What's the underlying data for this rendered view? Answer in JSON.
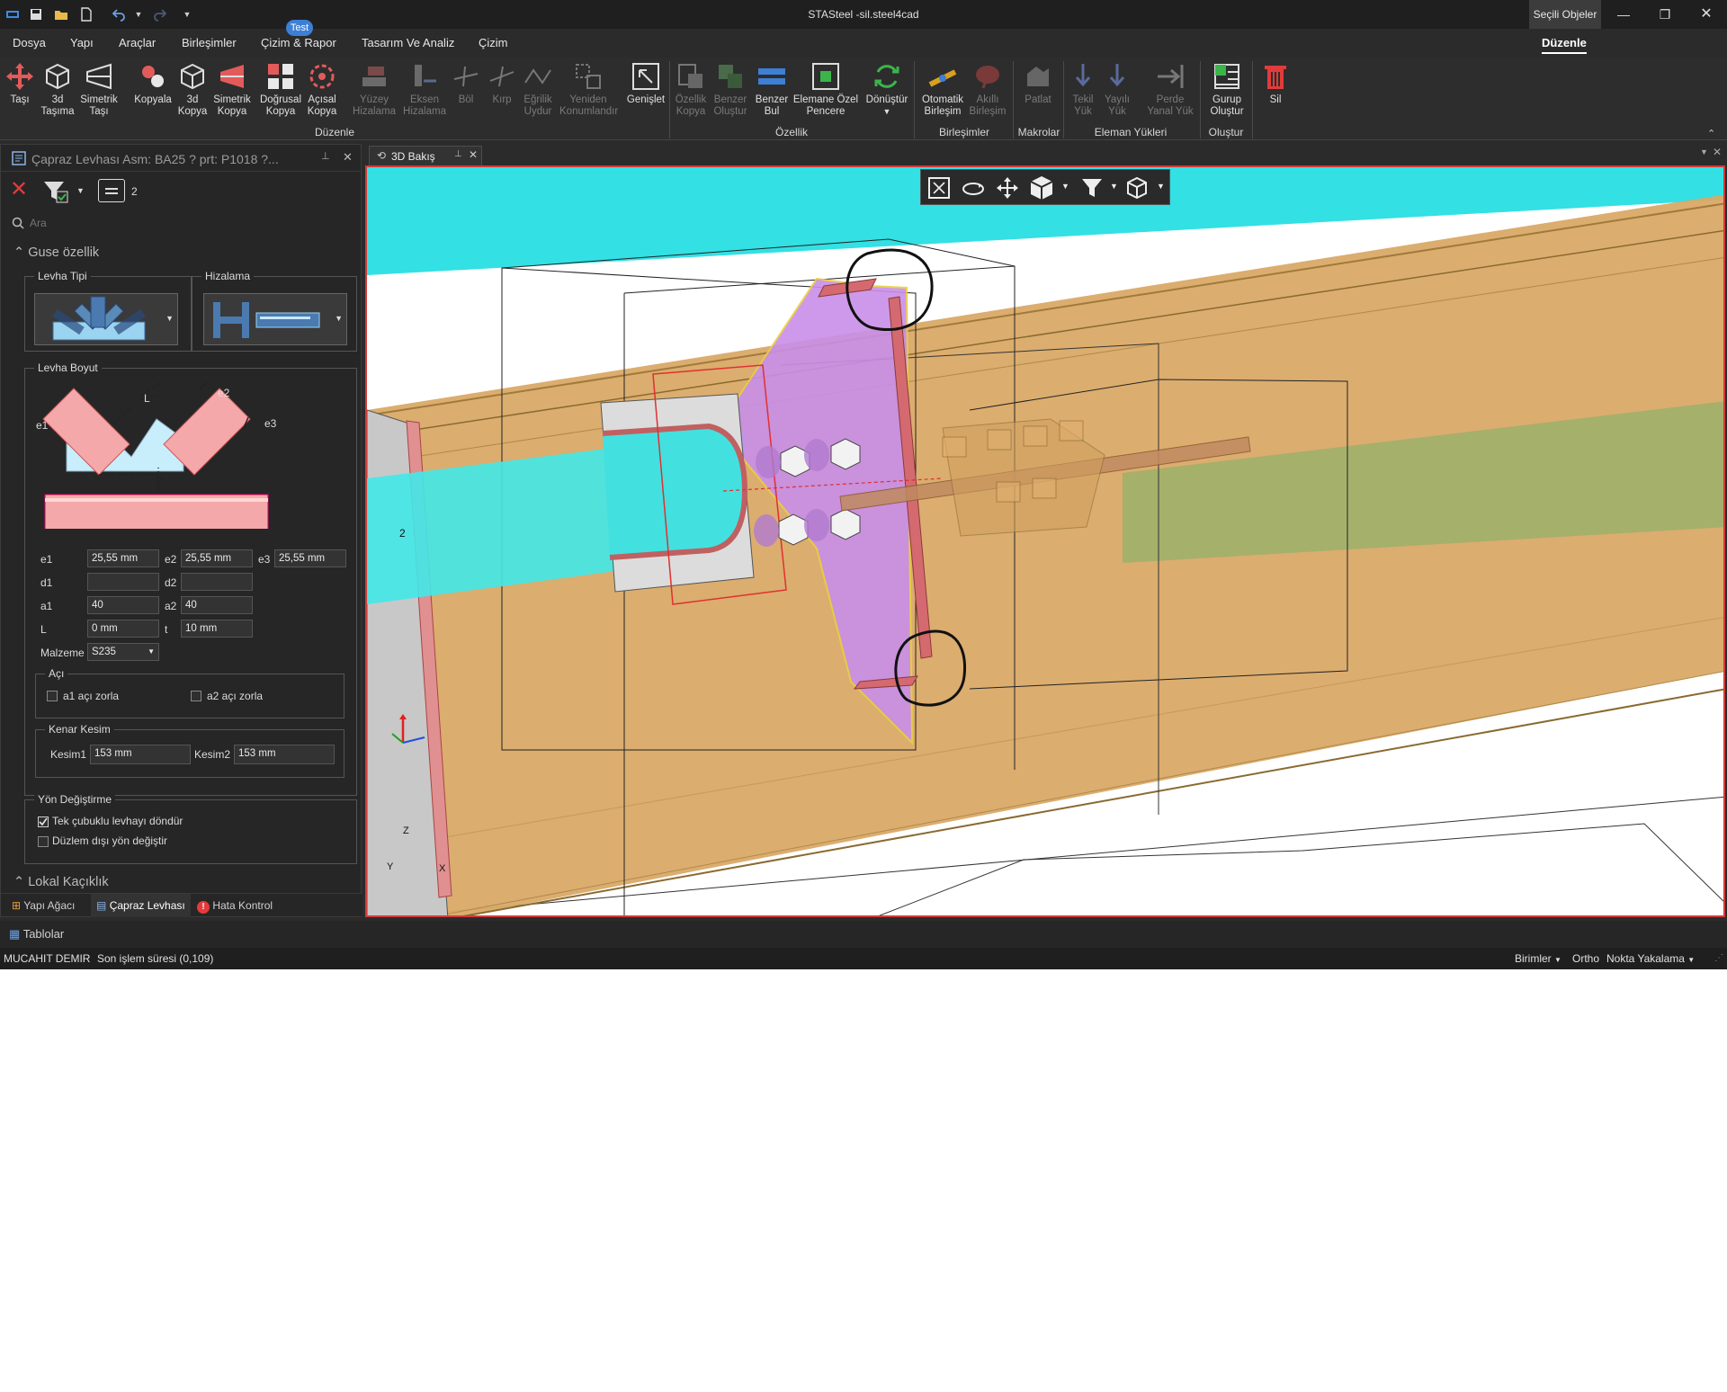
{
  "window": {
    "title": "STASteel -sil.steel4cad",
    "selected_objects_label": "Seçili Objeler"
  },
  "menu": {
    "items": [
      "Dosya",
      "Yapı",
      "Araçlar",
      "Birleşimler",
      "Çizim & Rapor",
      "Tasarım Ve Analiz",
      "Çizim"
    ],
    "test_badge": "Test",
    "active_tab": "Düzenle"
  },
  "ribbon": {
    "groups": {
      "duzenle": "Düzenle",
      "ozellik": "Özellik",
      "birlesimler": "Birleşimler",
      "makrolar": "Makrolar",
      "eleman_yukleri": "Eleman Yükleri",
      "olustur": "Oluştur"
    },
    "buttons": {
      "tasi": [
        "Taşı"
      ],
      "tasima3d": [
        "3d",
        "Taşıma"
      ],
      "simetrik_tasi": [
        "Simetrik",
        "Taşı"
      ],
      "kopyala": [
        "Kopyala"
      ],
      "kopya3d": [
        "3d",
        "Kopya"
      ],
      "simetrik_kopya": [
        "Simetrik",
        "Kopya"
      ],
      "dogrusal_kopya": [
        "Doğrusal",
        "Kopya"
      ],
      "acisal_kopya": [
        "Açısal",
        "Kopya"
      ],
      "yuzey_hizalama": [
        "Yüzey",
        "Hizalama"
      ],
      "eksen_hizalama": [
        "Eksen",
        "Hizalama"
      ],
      "bol": [
        "Böl"
      ],
      "kirp": [
        "Kırp"
      ],
      "egrilik_uydur": [
        "Eğrilik",
        "Uydur"
      ],
      "yeniden_konumlandir": [
        "Yeniden",
        "Konumlandır"
      ],
      "genislet": [
        "Genişlet"
      ],
      "ozellik_kopya": [
        "Özellik",
        "Kopya"
      ],
      "benzer_olustur": [
        "Benzer",
        "Oluştur"
      ],
      "benzer_bul": [
        "Benzer",
        "Bul"
      ],
      "elemana_ozel_pencere": [
        "Elemane Özel",
        "Pencere"
      ],
      "donustur": [
        "Dönüştür"
      ],
      "otomatik_birlesim": [
        "Otomatik",
        "Birleşim"
      ],
      "akilli_birlesim": [
        "Akıllı",
        "Birleşim"
      ],
      "patlat": [
        "Patlat"
      ],
      "tekil_yuk": [
        "Tekil",
        "Yük"
      ],
      "yayili_yuk": [
        "Yayılı",
        "Yük"
      ],
      "perde_yanal_yuk": [
        "Perde",
        "Yanal Yük"
      ],
      "gurup_olustur": [
        "Gurup",
        "Oluştur"
      ],
      "sil": [
        "Sil"
      ]
    }
  },
  "left_panel": {
    "title": "Çapraz Levhası  Asm: BA25 ? prt: P1018 ?...",
    "count": "2",
    "search_placeholder": "Ara",
    "section_guse": "Guse özellik",
    "levha_tipi": "Levha Tipi",
    "hizalama": "Hizalama",
    "levha_boyut": "Levha Boyut",
    "diagram_labels": {
      "L": "L",
      "e1": "e1",
      "e2": "e2",
      "e3": "e3"
    },
    "fields": {
      "e1_label": "e1",
      "e1_value": "25,55 mm",
      "e2_label": "e2",
      "e2_value": "25,55 mm",
      "e3_label": "e3",
      "e3_value": "25,55 mm",
      "d1_label": "d1",
      "d1_value": "",
      "d2_label": "d2",
      "d2_value": "",
      "a1_label": "a1",
      "a1_value": "40",
      "a2_label": "a2",
      "a2_value": "40",
      "L_label": "L",
      "L_value": "0 mm",
      "t_label": "t",
      "t_value": "10 mm",
      "malzeme_label": "Malzeme",
      "malzeme_value": "S235"
    },
    "aci": {
      "title": "Açı",
      "a1_force": "a1 açı zorla",
      "a1_checked": false,
      "a2_force": "a2 açı zorla",
      "a2_checked": false
    },
    "kenar_kesim": {
      "title": "Kenar Kesim",
      "kesim1_label": "Kesim1",
      "kesim1_value": "153 mm",
      "kesim2_label": "Kesim2",
      "kesim2_value": "153 mm"
    },
    "yon": {
      "title": "Yön Değiştirme",
      "tek_cubuk": "Tek çubuklu levhayı döndür",
      "tek_cubuk_checked": true,
      "duzlem_disi": "Düzlem dışı yön değiştir",
      "duzlem_disi_checked": false
    },
    "section_lokal": "Lokal Kaçıklık",
    "bottom_tabs": [
      "Yapı Ağacı",
      "Çapraz Levhası",
      "Hata Kontrol"
    ]
  },
  "viewport": {
    "tab_label": "3D Bakış",
    "member_label": "2",
    "axis_labels": {
      "z": "Z",
      "y": "Y",
      "x": "X"
    }
  },
  "tables_label": "Tablolar",
  "status": {
    "user": "MUCAHIT DEMIR",
    "last_op": "Son işlem süresi (0,109)",
    "units": "Birimler",
    "ortho": "Ortho",
    "snap": "Nokta Yakalama"
  },
  "colors": {
    "app_bg": "#2b2b2b",
    "accent_blue": "#3d7fd4",
    "viewport_border": "#d43a3a",
    "gusset_plate": "#c98fe8",
    "member_tan": "#d9a967",
    "brace_cyan": "#34e3e6"
  }
}
